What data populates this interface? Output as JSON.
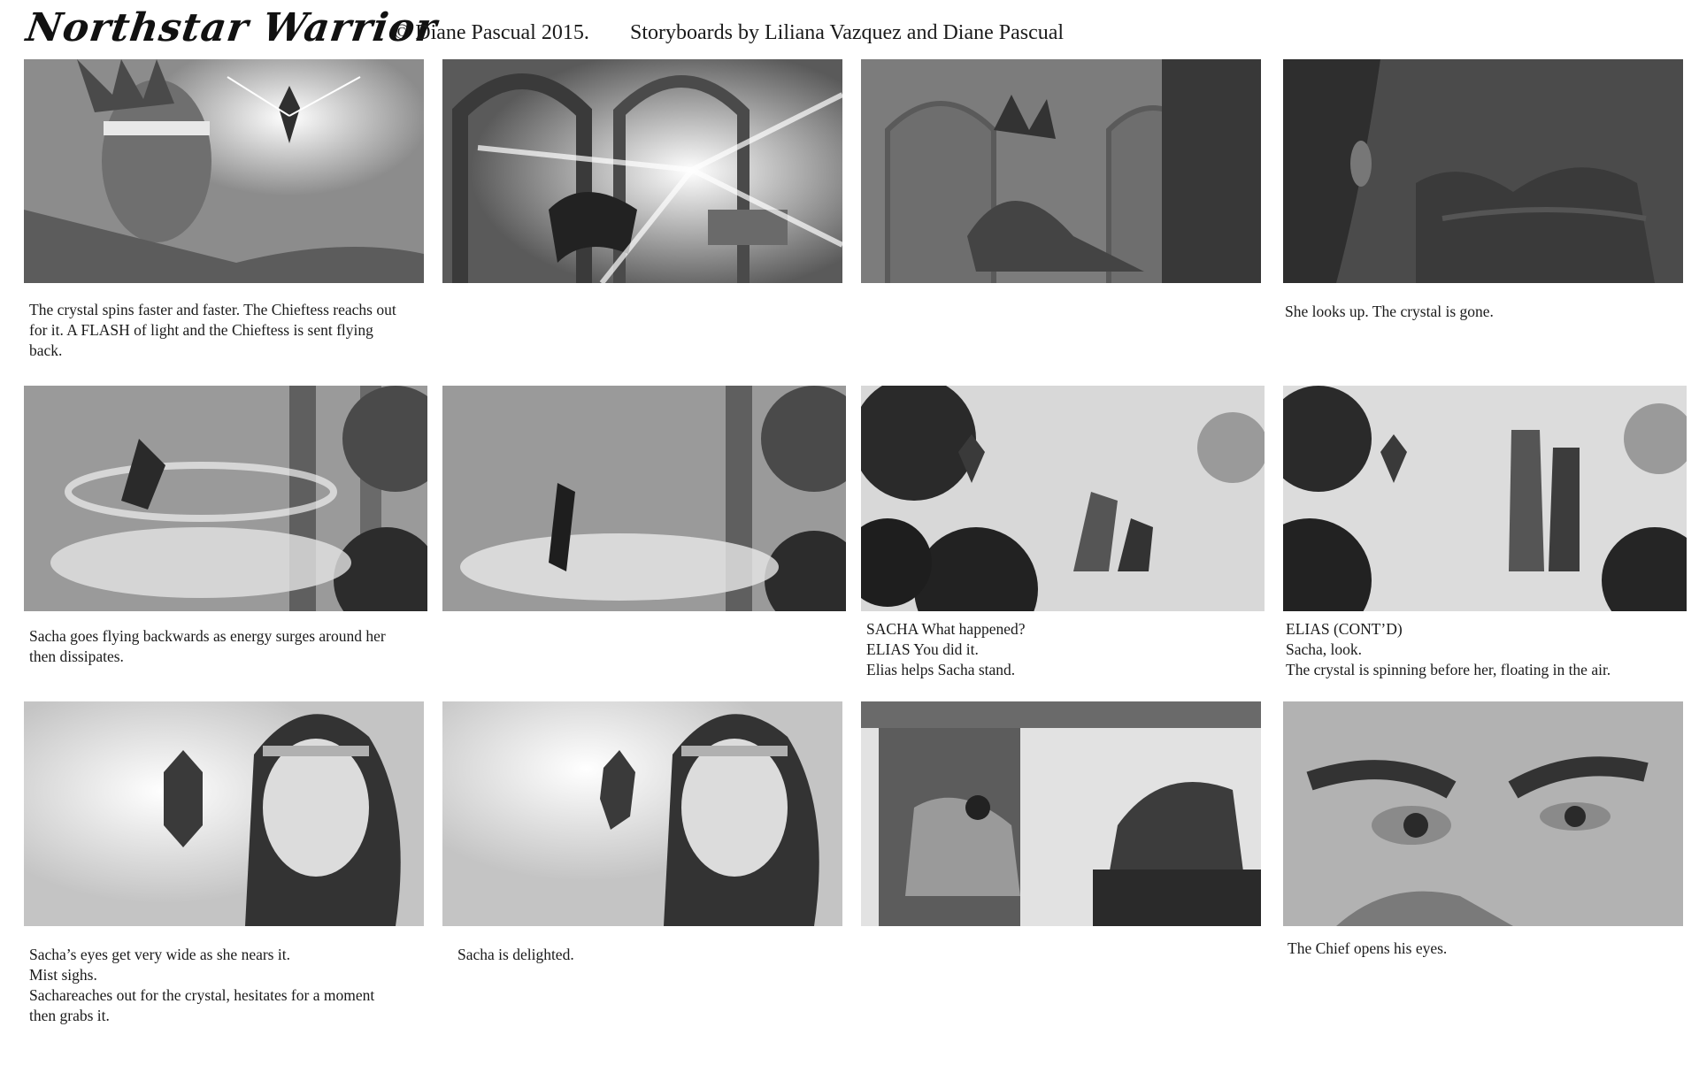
{
  "header": {
    "title": "Northstar Warrior",
    "copyright": "© Diane Pascual 2015.",
    "credits": "Storyboards by Liliana Vazquez and Diane Pascual"
  },
  "panels": [
    {
      "scene": "chieftess-crystal",
      "caption": [
        "The crystal spins faster and faster. The Chieftess reachs out",
        "for it. A FLASH of light and the Chieftess is sent flying",
        "back."
      ]
    },
    {
      "scene": "light-flash",
      "caption": []
    },
    {
      "scene": "dark-chamber",
      "caption": []
    },
    {
      "scene": "dark-closeup",
      "caption": [
        "She looks up. The crystal is gone."
      ]
    },
    {
      "scene": "forest-surge",
      "caption": [
        "Sacha goes flying backwards as energy surges around her",
        "then dissipates."
      ]
    },
    {
      "scene": "forest-fall",
      "caption": []
    },
    {
      "scene": "forest-help",
      "caption": [
        "SACHA What happened?",
        "ELIAS You did it.",
        "Elias helps Sacha stand."
      ]
    },
    {
      "scene": "forest-stand",
      "caption": [
        "ELIAS (CONT’D)",
        "Sacha, look.",
        "The crystal is spinning before her, floating in the air."
      ]
    },
    {
      "scene": "sacha-wide-eyes",
      "caption": [
        "Sacha’s eyes get very wide as she nears it.",
        "Mist sighs.",
        "Sachareaches out for the crystal, hesitates for a moment",
        "then grabs it."
      ]
    },
    {
      "scene": "sacha-delighted",
      "caption": [
        "Sacha is delighted."
      ]
    },
    {
      "scene": "bedroom",
      "caption": []
    },
    {
      "scene": "chief-eyes",
      "caption": [
        "The Chief opens his eyes."
      ]
    }
  ]
}
